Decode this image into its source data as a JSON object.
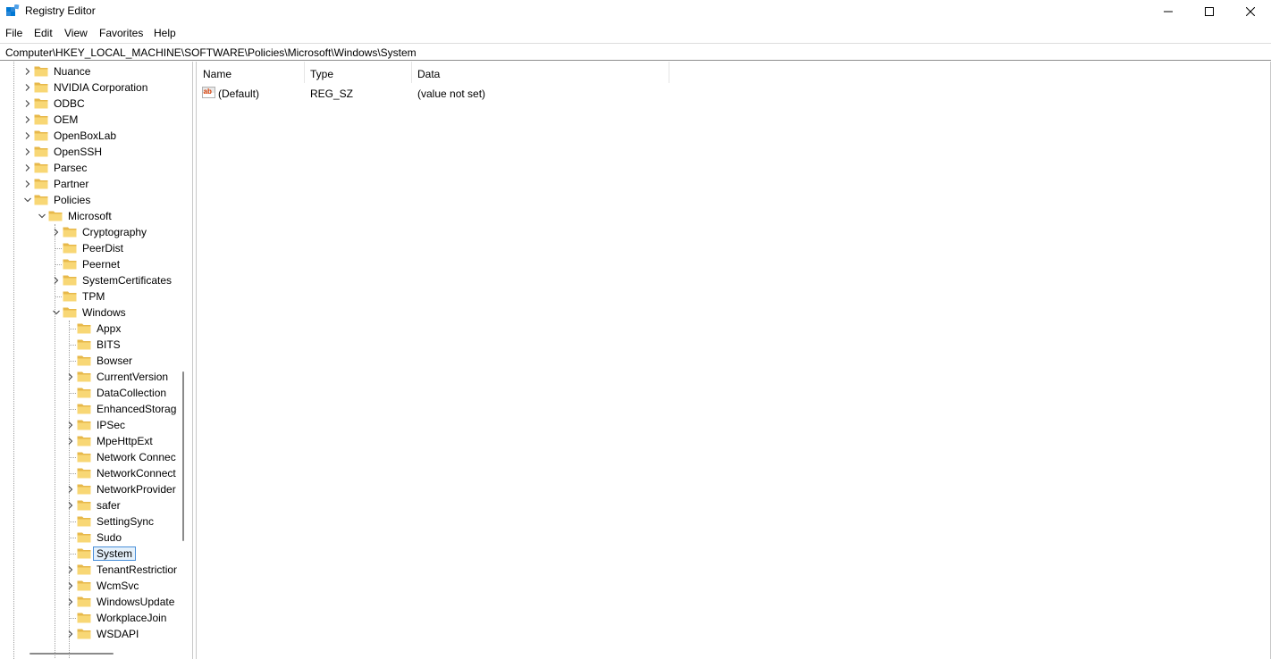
{
  "window": {
    "title": "Registry Editor",
    "controls": {
      "minimize": "minimize",
      "maximize": "maximize",
      "close": "close"
    }
  },
  "menu": [
    "File",
    "Edit",
    "View",
    "Favorites",
    "Help"
  ],
  "address": "Computer\\HKEY_LOCAL_MACHINE\\SOFTWARE\\Policies\\Microsoft\\Windows\\System",
  "tree": [
    {
      "label": "Nuance",
      "level": 0,
      "expander": "collapsed"
    },
    {
      "label": "NVIDIA Corporation",
      "level": 0,
      "expander": "collapsed"
    },
    {
      "label": "ODBC",
      "level": 0,
      "expander": "collapsed"
    },
    {
      "label": "OEM",
      "level": 0,
      "expander": "collapsed"
    },
    {
      "label": "OpenBoxLab",
      "level": 0,
      "expander": "collapsed"
    },
    {
      "label": "OpenSSH",
      "level": 0,
      "expander": "collapsed"
    },
    {
      "label": "Parsec",
      "level": 0,
      "expander": "collapsed"
    },
    {
      "label": "Partner",
      "level": 0,
      "expander": "collapsed"
    },
    {
      "label": "Policies",
      "level": 0,
      "expander": "expanded"
    },
    {
      "label": "Microsoft",
      "level": 1,
      "expander": "expanded"
    },
    {
      "label": "Cryptography",
      "level": 2,
      "expander": "collapsed"
    },
    {
      "label": "PeerDist",
      "level": 2,
      "expander": "none"
    },
    {
      "label": "Peernet",
      "level": 2,
      "expander": "none"
    },
    {
      "label": "SystemCertificates",
      "level": 2,
      "expander": "collapsed"
    },
    {
      "label": "TPM",
      "level": 2,
      "expander": "none"
    },
    {
      "label": "Windows",
      "level": 2,
      "expander": "expanded"
    },
    {
      "label": "Appx",
      "level": 3,
      "expander": "none"
    },
    {
      "label": "BITS",
      "level": 3,
      "expander": "none"
    },
    {
      "label": "Bowser",
      "level": 3,
      "expander": "none"
    },
    {
      "label": "CurrentVersion",
      "level": 3,
      "expander": "collapsed"
    },
    {
      "label": "DataCollection",
      "level": 3,
      "expander": "none"
    },
    {
      "label": "EnhancedStorage",
      "level": 3,
      "expander": "none"
    },
    {
      "label": "IPSec",
      "level": 3,
      "expander": "collapsed"
    },
    {
      "label": "MpeHttpExt",
      "level": 3,
      "expander": "collapsed"
    },
    {
      "label": "Network Connec",
      "level": 3,
      "expander": "none"
    },
    {
      "label": "NetworkConnect",
      "level": 3,
      "expander": "none"
    },
    {
      "label": "NetworkProvider",
      "level": 3,
      "expander": "collapsed"
    },
    {
      "label": "safer",
      "level": 3,
      "expander": "collapsed"
    },
    {
      "label": "SettingSync",
      "level": 3,
      "expander": "none"
    },
    {
      "label": "Sudo",
      "level": 3,
      "expander": "none"
    },
    {
      "label": "System",
      "level": 3,
      "expander": "none",
      "selected": true
    },
    {
      "label": "TenantRestriction",
      "level": 3,
      "expander": "collapsed"
    },
    {
      "label": "WcmSvc",
      "level": 3,
      "expander": "collapsed"
    },
    {
      "label": "WindowsUpdate",
      "level": 3,
      "expander": "collapsed"
    },
    {
      "label": "WorkplaceJoin",
      "level": 3,
      "expander": "none"
    },
    {
      "label": "WSDAPI",
      "level": 3,
      "expander": "collapsed"
    }
  ],
  "list": {
    "columns": [
      "Name",
      "Type",
      "Data"
    ],
    "rows": [
      {
        "name": "(Default)",
        "type": "REG_SZ",
        "data": "(value not set)",
        "icon": "string-value-icon"
      }
    ]
  },
  "colors": {
    "folder": "#f8d775",
    "folder_dark": "#e7b84a",
    "selection_bg": "#e5f1fb",
    "selection_border": "#4a90d9",
    "accent": "#0078d4"
  }
}
